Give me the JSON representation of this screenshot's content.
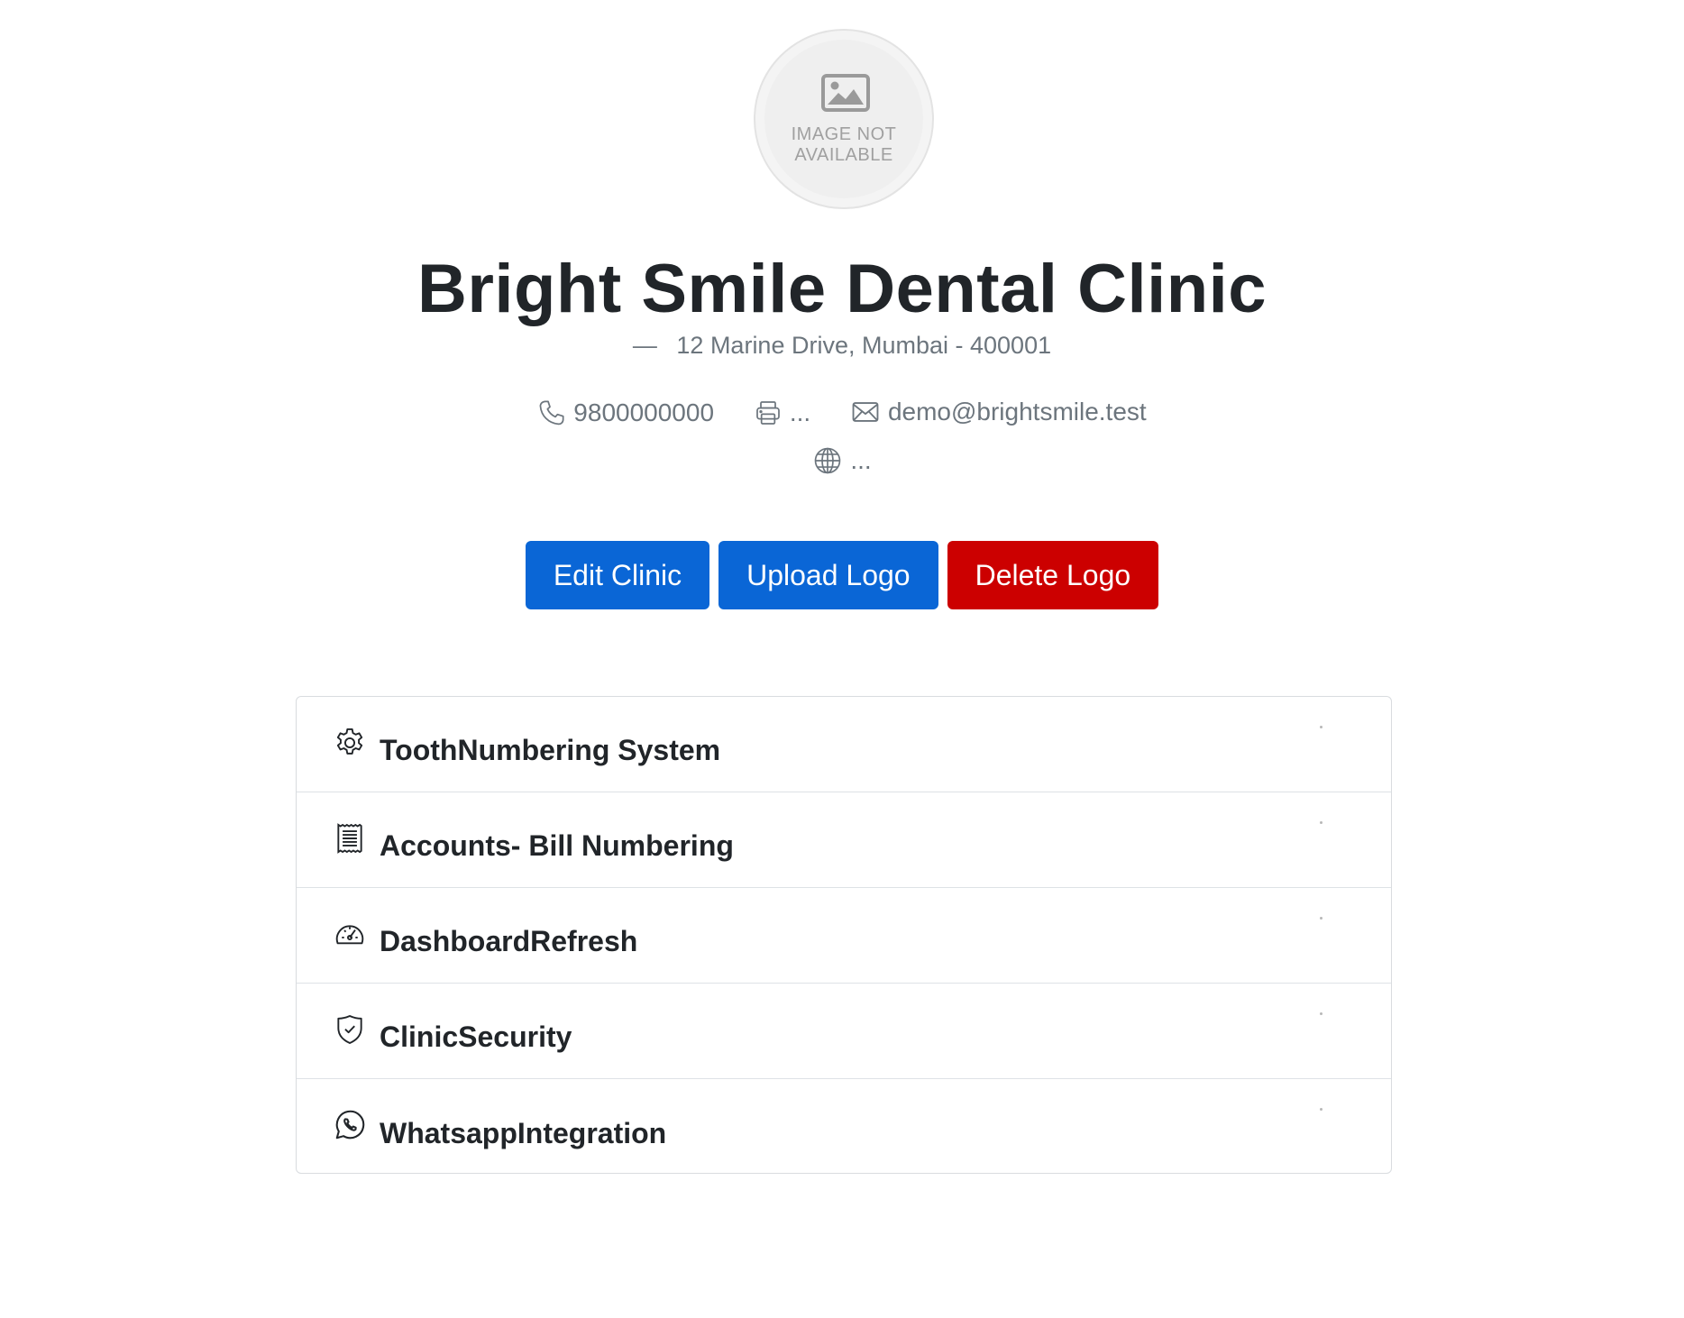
{
  "logo": {
    "placeholder_text": "IMAGE NOT\nAVAILABLE",
    "icon": "image-icon"
  },
  "clinic": {
    "name": "Bright Smile Dental Clinic",
    "address_dash": "—",
    "address": "12 Marine Drive, Mumbai - 400001",
    "phone": "9800000000",
    "fax": "...",
    "email": "demo@brightsmile.test",
    "website": "..."
  },
  "actions": {
    "edit_label": "Edit Clinic",
    "upload_label": "Upload Logo",
    "delete_label": "Delete Logo"
  },
  "colors": {
    "primary": "#0a66d6",
    "danger": "#cc0000"
  },
  "settings": {
    "items": [
      {
        "label": "ToothNumbering System",
        "icon": "gear-icon"
      },
      {
        "label": "Accounts- Bill Numbering",
        "icon": "receipt-icon"
      },
      {
        "label": "DashboardRefresh",
        "icon": "speedometer-icon"
      },
      {
        "label": "ClinicSecurity",
        "icon": "shield-check-icon"
      },
      {
        "label": "WhatsappIntegration",
        "icon": "whatsapp-icon"
      }
    ]
  }
}
